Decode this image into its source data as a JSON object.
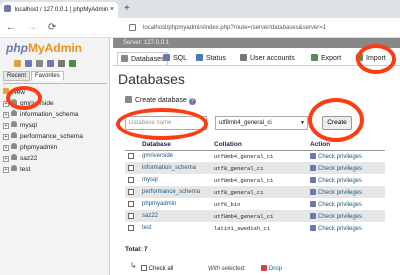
{
  "browser": {
    "tab_title": "localhost / 127.0.0.1 | phpMyAdmin",
    "tab_close": "×",
    "new_tab": "+",
    "back": "←",
    "forward": "→",
    "reload": "⟳",
    "url": "localhost/phpmyadmin/index.php?route=/server/databases&server=1"
  },
  "sidebar": {
    "logo_php": "php",
    "logo_my": "My",
    "logo_admin": "Admin",
    "tabs": [
      {
        "label": "Recent"
      },
      {
        "label": "Favorites"
      }
    ],
    "new_label": "New",
    "databases": [
      {
        "name": "gmriverside"
      },
      {
        "name": "information_schema"
      },
      {
        "name": "mysql"
      },
      {
        "name": "performance_schema"
      },
      {
        "name": "phpmyadmin"
      },
      {
        "name": "saz22"
      },
      {
        "name": "test"
      }
    ]
  },
  "server": {
    "label": "Server: 127.0.0.1"
  },
  "topnav": {
    "items": [
      {
        "label": "Databases",
        "icon": "database-icon"
      },
      {
        "label": "SQL",
        "icon": "sql-icon"
      },
      {
        "label": "Status",
        "icon": "status-icon"
      },
      {
        "label": "User accounts",
        "icon": "users-icon"
      },
      {
        "label": "Export",
        "icon": "export-icon"
      },
      {
        "label": "Import",
        "icon": "import-icon"
      }
    ]
  },
  "main": {
    "heading": "Databases",
    "create_label": "Create database",
    "db_name_placeholder": "Database name",
    "collation_value": "utf8mb4_general_ci",
    "create_button": "Create",
    "columns": {
      "database": "Database",
      "collation": "Collation",
      "action": "Action"
    },
    "action_label": "Check privileges",
    "rows": [
      {
        "name": "gmriverside",
        "collation": "utf8mb4_general_ci"
      },
      {
        "name": "information_schema",
        "collation": "utf8_general_ci"
      },
      {
        "name": "mysql",
        "collation": "utf8mb4_general_ci"
      },
      {
        "name": "performance_schema",
        "collation": "utf8_general_ci"
      },
      {
        "name": "phpmyadmin",
        "collation": "utf8_bin"
      },
      {
        "name": "saz22",
        "collation": "utf8mb4_general_ci"
      },
      {
        "name": "test",
        "collation": "latin1_swedish_ci"
      }
    ],
    "total": "Total: 7",
    "check_all": "Check all",
    "with_selected": "With selected:",
    "drop": "Drop"
  },
  "colors": {
    "annotation": "#ff3b12",
    "link": "#235a81",
    "accent": "#6c78af",
    "logo_orange": "#f29111"
  }
}
